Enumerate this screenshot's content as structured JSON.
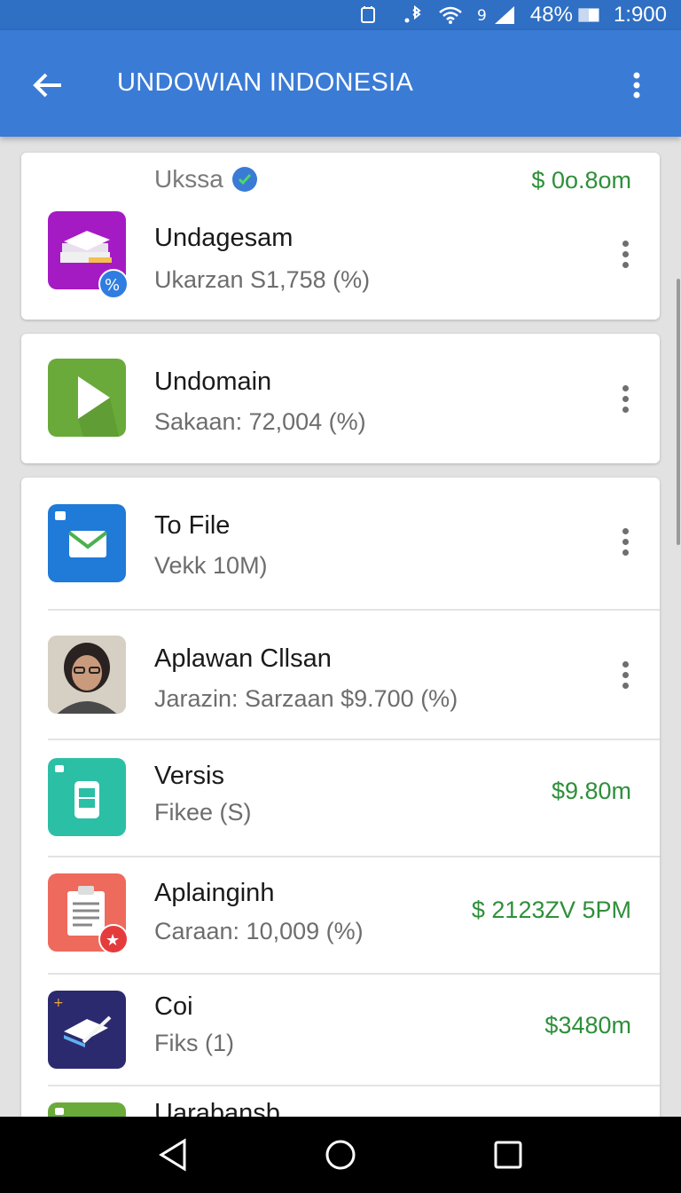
{
  "status_bar": {
    "battery": "48%",
    "time": "1:900",
    "icons": [
      "sync-icon",
      "bluetooth-icon",
      "wifi-icon",
      "signal-icon",
      "battery-icon"
    ]
  },
  "app_bar": {
    "title": "UNDOWIAN INDONESIA",
    "back_icon": "arrow-left-icon",
    "menu_icon": "overflow-menu-icon"
  },
  "cards": [
    {
      "header_label": "Ukssa",
      "header_price": "$ 0o.8om",
      "items": [
        {
          "title": "Undagesam",
          "subtitle": "Ukarzan S1,758 (%)",
          "icon": "books-icon",
          "icon_color": "#a41bc4"
        }
      ]
    },
    {
      "items": [
        {
          "title": "Undomain",
          "subtitle": "Sakaan: 72,004 (%)",
          "icon": "play-icon",
          "icon_color": "#6aaa3a"
        }
      ]
    },
    {
      "items": [
        {
          "title": "To File",
          "subtitle": "Vekk 10M)",
          "icon": "mail-icon",
          "icon_color": "#1f7ad8"
        },
        {
          "title": "Aplawan Cllsan",
          "subtitle": "Jarazin: Sarzaan $9.700 (%)",
          "icon": "avatar-photo"
        },
        {
          "title": "Versis",
          "subtitle": "Fikee (S)",
          "price": "$9.80m",
          "icon": "phone-icon",
          "icon_color": "#2bbfa6"
        },
        {
          "title": "Aplainginh",
          "subtitle": "Caraan: 10,009 (%)",
          "price": "$ 2123ZV 5PM",
          "icon": "document-icon",
          "icon_color": "#ee6a5c"
        },
        {
          "title": "Coi",
          "subtitle": "Fiks (1)",
          "price": "$3480m",
          "icon": "edit-book-icon",
          "icon_color": "#2c2a6e"
        },
        {
          "title": "Uarabansb",
          "subtitle": "",
          "icon": "app-icon",
          "icon_color": "#6aaa3a"
        }
      ]
    }
  ],
  "nav_bar": {
    "buttons": [
      "back-triangle-icon",
      "home-circle-icon",
      "recents-square-icon"
    ]
  }
}
